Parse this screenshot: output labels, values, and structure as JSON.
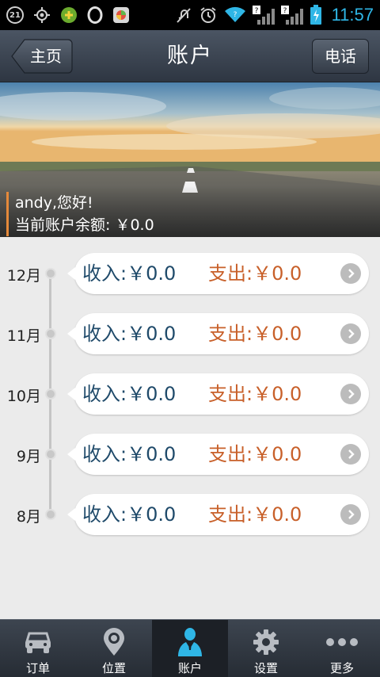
{
  "status_bar": {
    "notification_badge": "21",
    "time": "11:57",
    "icons": [
      "gps-icon",
      "app-icon",
      "opera-icon",
      "app-icon-2",
      "mute-icon",
      "alarm-icon",
      "wifi-icon",
      "signal-icon",
      "signal-icon-2",
      "battery-icon"
    ]
  },
  "header": {
    "back_label": "主页",
    "title": "账户",
    "phone_label": "电话"
  },
  "banner": {
    "greeting": "andy,您好!",
    "balance_line": "当前账户余额: ￥0.0"
  },
  "timeline": {
    "rows": [
      {
        "month": "12月",
        "income": "收入:￥0.0",
        "expense": "支出:￥0.0"
      },
      {
        "month": "11月",
        "income": "收入:￥0.0",
        "expense": "支出:￥0.0"
      },
      {
        "month": "10月",
        "income": "收入:￥0.0",
        "expense": "支出:￥0.0"
      },
      {
        "month": "9月",
        "income": "收入:￥0.0",
        "expense": "支出:￥0.0"
      },
      {
        "month": "8月",
        "income": "收入:￥0.0",
        "expense": "支出:￥0.0"
      }
    ]
  },
  "tabs": [
    {
      "label": "订单",
      "icon": "car-icon",
      "active": false
    },
    {
      "label": "位置",
      "icon": "location-pin-icon",
      "active": false
    },
    {
      "label": "账户",
      "icon": "user-icon",
      "active": true
    },
    {
      "label": "设置",
      "icon": "gear-icon",
      "active": false
    },
    {
      "label": "更多",
      "icon": "more-dots-icon",
      "active": false
    }
  ],
  "colors": {
    "accent": "#2fb6e6",
    "income_text": "#1f4a6a",
    "expense_text": "#c8602a",
    "banner_bar": "#e5893a"
  }
}
